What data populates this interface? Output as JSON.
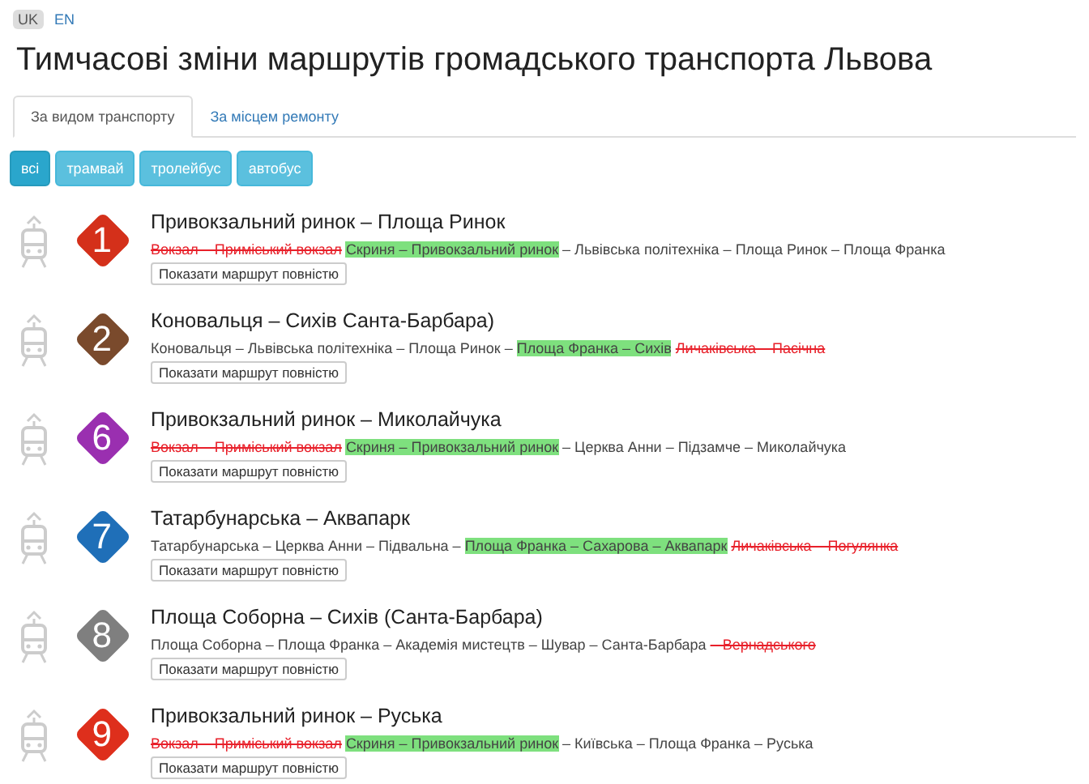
{
  "languages": [
    {
      "label": "UK",
      "selected": true
    },
    {
      "label": "EN",
      "selected": false
    }
  ],
  "title": "Тимчасові зміни маршрутів громадського транспорта Львова",
  "tabs": [
    {
      "label": "За видом транспорту",
      "selected": true
    },
    {
      "label": "За місцем ремонту",
      "selected": false
    }
  ],
  "filters": [
    {
      "label": "всі",
      "selected": true
    },
    {
      "label": "трамвай",
      "selected": false
    },
    {
      "label": "тролейбус",
      "selected": false
    },
    {
      "label": "автобус",
      "selected": false
    }
  ],
  "routes": [
    {
      "number": "1",
      "color": "#d4301a",
      "name": "Привокзальний ринок – Площа Ринок",
      "segments": [
        {
          "kind": "cancelled",
          "text": "Вокзал – Приміський вокзал"
        },
        {
          "kind": "detour",
          "text": "Скриня – Привокзальний ринок"
        },
        {
          "kind": "normal",
          "text": "– Львівська політехніка – Площа Ринок – Площа Франка"
        }
      ],
      "button": "Показати маршрут повністю"
    },
    {
      "number": "2",
      "color": "#7a4a2c",
      "name": "Коновальця – Сихів Санта-Барбара)",
      "segments": [
        {
          "kind": "normal",
          "text": "Коновальця – Львівська політехніка – Площа Ринок –"
        },
        {
          "kind": "detour",
          "text": "Площа Франка – Сихів"
        },
        {
          "kind": "cancelled",
          "text": "Личаківська – Пасічна"
        }
      ],
      "button": "Показати маршрут повністю"
    },
    {
      "number": "6",
      "color": "#9a2fb0",
      "name": "Привокзальний ринок – Миколайчука",
      "segments": [
        {
          "kind": "cancelled",
          "text": "Вокзал – Приміський вокзал"
        },
        {
          "kind": "detour",
          "text": "Скриня – Привокзальний ринок"
        },
        {
          "kind": "normal",
          "text": "– Церква Анни – Підзамче – Миколайчука"
        }
      ],
      "button": "Показати маршрут повністю"
    },
    {
      "number": "7",
      "color": "#1f6fb8",
      "name": "Татарбунарська – Аквапарк",
      "segments": [
        {
          "kind": "normal",
          "text": "Татарбунарська – Церква Анни – Підвальна –"
        },
        {
          "kind": "detour",
          "text": "Площа Франка – Сахарова – Аквапарк"
        },
        {
          "kind": "cancelled",
          "text": "Личаківська – Погулянка"
        }
      ],
      "button": "Показати маршрут повністю"
    },
    {
      "number": "8",
      "color": "#7f7f7f",
      "name": "Площа Соборна – Сихів (Санта-Барбара)",
      "segments": [
        {
          "kind": "normal",
          "text": "Площа Соборна – Площа Франка – Академія мистецтв – Шувар – Санта-Барбара"
        },
        {
          "kind": "cancelled",
          "text": "– Вернадського"
        }
      ],
      "button": "Показати маршрут повністю"
    },
    {
      "number": "9",
      "color": "#de2f1c",
      "name": "Привокзальний ринок – Руська",
      "segments": [
        {
          "kind": "cancelled",
          "text": "Вокзал – Приміський вокзал"
        },
        {
          "kind": "detour",
          "text": "Скриня – Привокзальний ринок"
        },
        {
          "kind": "normal",
          "text": "– Київська – Площа Франка – Руська"
        }
      ],
      "button": "Показати маршрут повністю"
    }
  ]
}
